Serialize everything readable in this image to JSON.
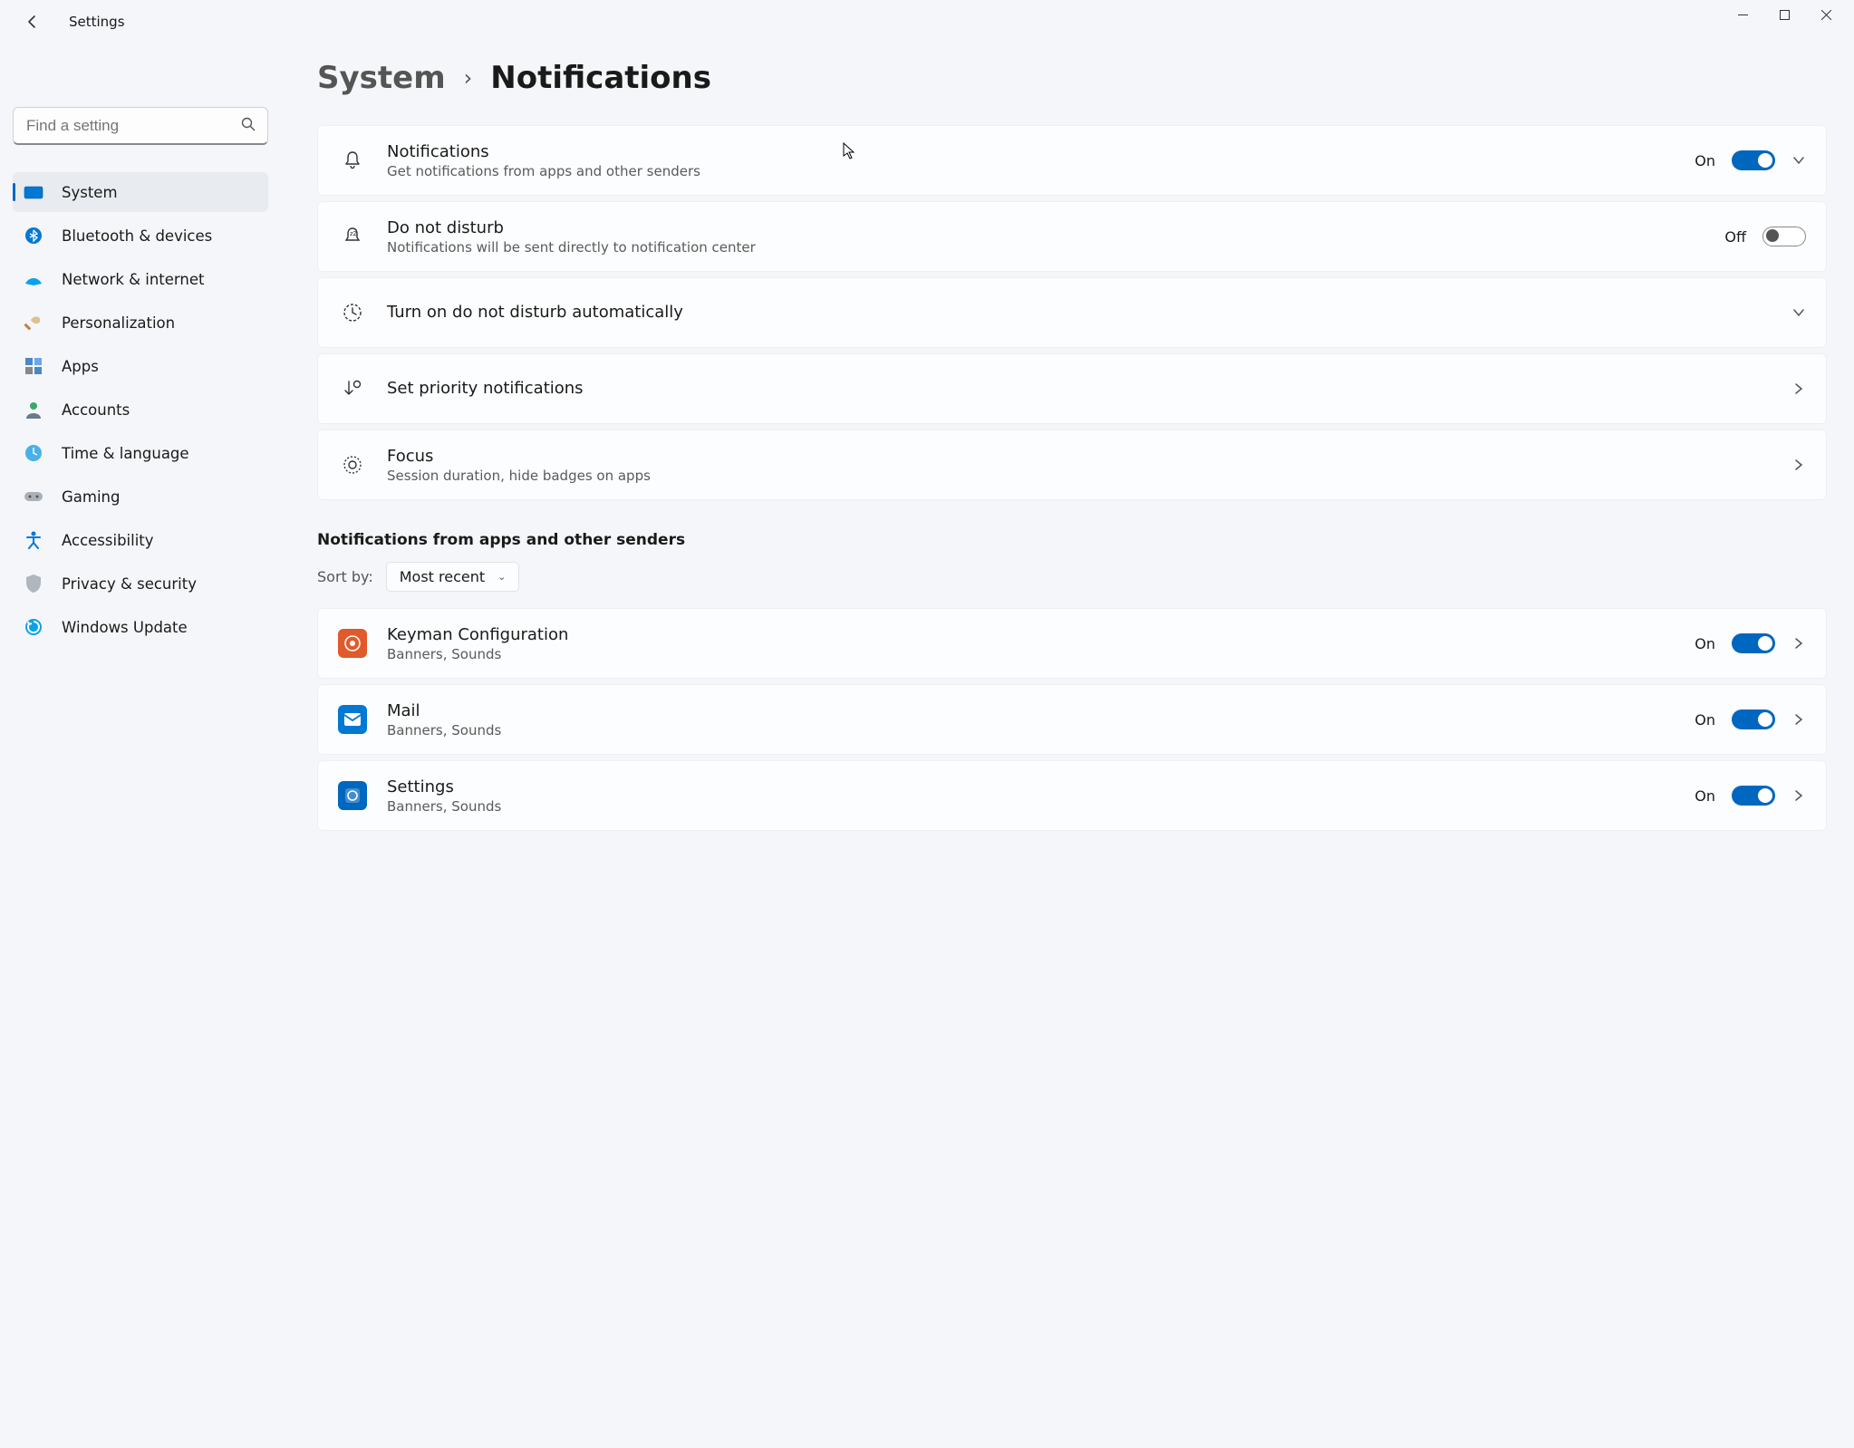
{
  "window": {
    "title": "Settings"
  },
  "search": {
    "placeholder": "Find a setting"
  },
  "nav": {
    "items": [
      {
        "key": "system",
        "label": "System",
        "active": true
      },
      {
        "key": "bluetooth",
        "label": "Bluetooth & devices",
        "active": false
      },
      {
        "key": "network",
        "label": "Network & internet",
        "active": false
      },
      {
        "key": "personalization",
        "label": "Personalization",
        "active": false
      },
      {
        "key": "apps",
        "label": "Apps",
        "active": false
      },
      {
        "key": "accounts",
        "label": "Accounts",
        "active": false
      },
      {
        "key": "time",
        "label": "Time & language",
        "active": false
      },
      {
        "key": "gaming",
        "label": "Gaming",
        "active": false
      },
      {
        "key": "accessibility",
        "label": "Accessibility",
        "active": false
      },
      {
        "key": "privacy",
        "label": "Privacy & security",
        "active": false
      },
      {
        "key": "update",
        "label": "Windows Update",
        "active": false
      }
    ]
  },
  "breadcrumb": {
    "root": "System",
    "leaf": "Notifications"
  },
  "cards": {
    "notifications": {
      "title": "Notifications",
      "sub": "Get notifications from apps and other senders",
      "state_label": "On",
      "state": true
    },
    "dnd": {
      "title": "Do not disturb",
      "sub": "Notifications will be sent directly to notification center",
      "state_label": "Off",
      "state": false
    },
    "auto_dnd": {
      "title": "Turn on do not disturb automatically"
    },
    "priority": {
      "title": "Set priority notifications"
    },
    "focus": {
      "title": "Focus",
      "sub": "Session duration, hide badges on apps"
    }
  },
  "apps_section": {
    "header": "Notifications from apps and other senders",
    "sort_label": "Sort by:",
    "sort_value": "Most recent",
    "apps": [
      {
        "key": "keyman",
        "name": "Keyman Configuration",
        "sub": "Banners, Sounds",
        "state_label": "On",
        "state": true
      },
      {
        "key": "mail",
        "name": "Mail",
        "sub": "Banners, Sounds",
        "state_label": "On",
        "state": true
      },
      {
        "key": "settings",
        "name": "Settings",
        "sub": "Banners, Sounds",
        "state_label": "On",
        "state": true
      }
    ]
  }
}
